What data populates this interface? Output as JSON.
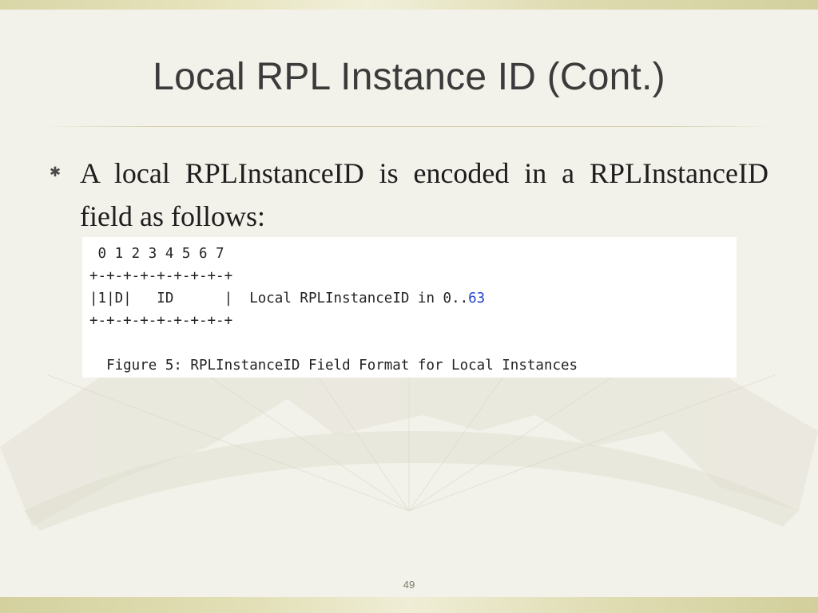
{
  "slide": {
    "title": "Local RPL Instance ID (Cont.)",
    "bullet_text": "A local RPLInstanceID is encoded in a RPLInstanceID field as follows:",
    "page_number": "49"
  },
  "figure": {
    "bit_positions": " 0 1 2 3 4 5 6 7",
    "border_top": "+-+-+-+-+-+-+-+-+",
    "field_row": "|1|D|   ID      |",
    "field_description": "Local RPLInstanceID in 0..",
    "field_range_max": "63",
    "border_bottom": "+-+-+-+-+-+-+-+-+",
    "caption": "Figure 5: RPLInstanceID Field Format for Local Instances"
  },
  "theme": {
    "background": "#f3f2ea",
    "band_color": "#d9d6a8",
    "title_color": "#3b3b3b",
    "link_color": "#2244cc"
  }
}
